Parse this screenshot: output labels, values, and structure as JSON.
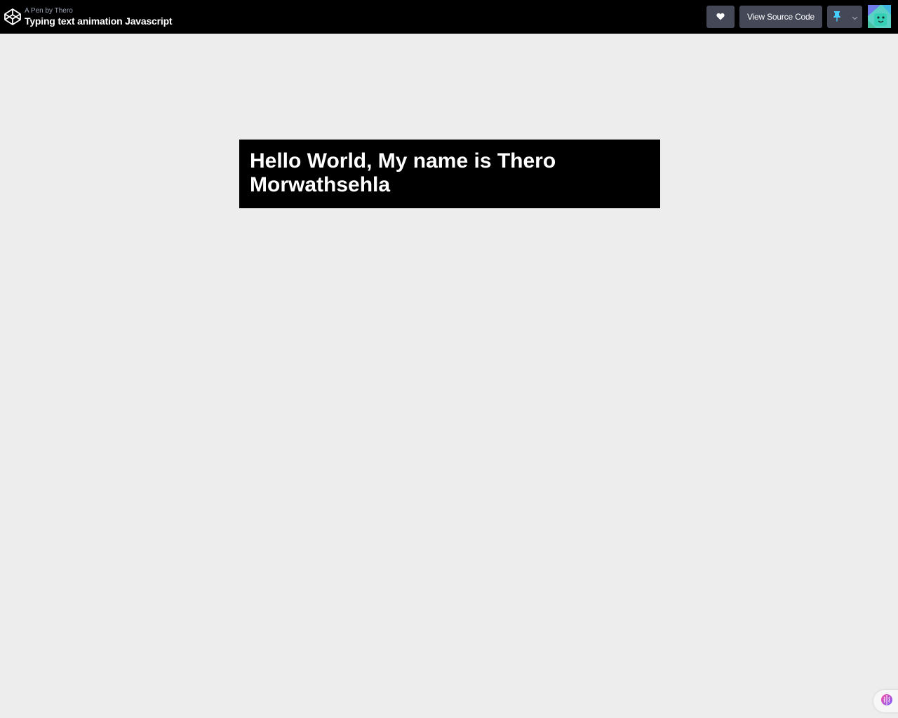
{
  "header": {
    "author_line": "A Pen by Thero",
    "title": "Typing text animation Javascript",
    "view_source_label": "View Source Code"
  },
  "icons": {
    "logo": "codepen-logo-icon",
    "heart": "heart-icon",
    "pin": "pin-icon",
    "chevron": "chevron-down-icon",
    "brain": "brain-icon"
  },
  "colors": {
    "topbar_bg": "#000000",
    "button_bg": "#444857",
    "page_bg": "#ededed",
    "banner_bg": "#000000",
    "banner_text": "#ffffff",
    "pin_color": "#47cfff"
  },
  "banner": {
    "text": "Hello World, My name is Thero Morwathsehla"
  }
}
